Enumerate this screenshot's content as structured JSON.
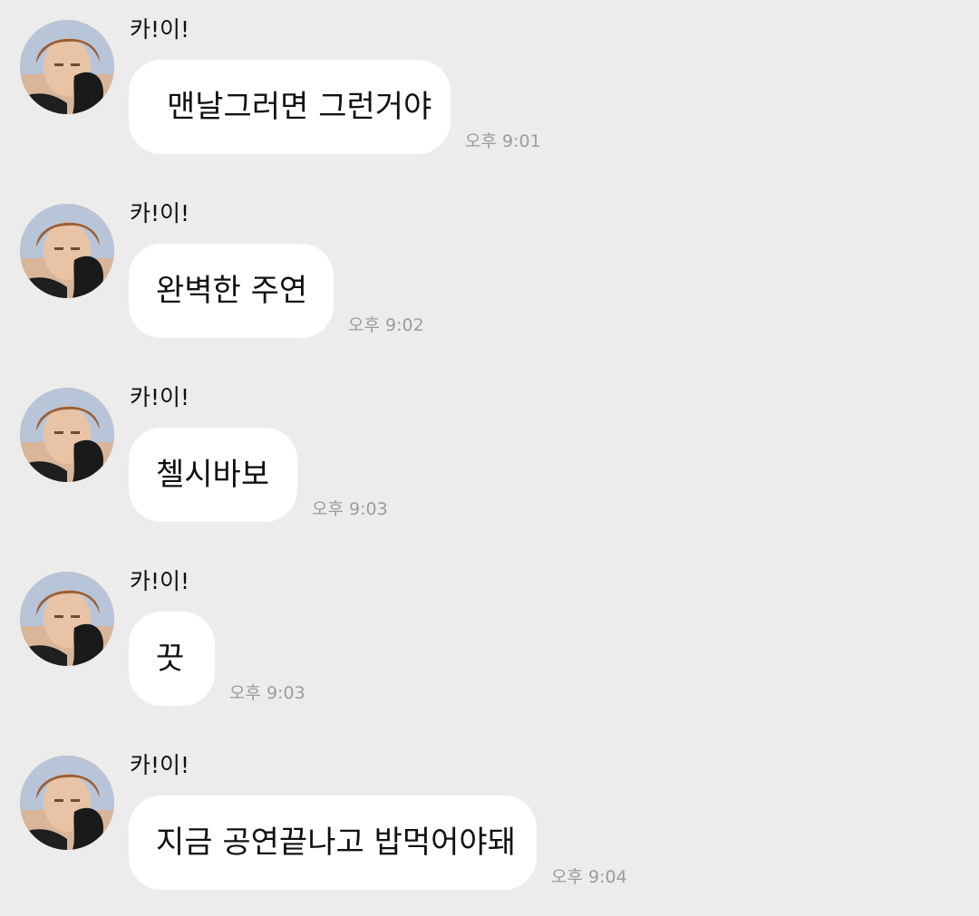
{
  "messages": [
    {
      "sender": "카!이!",
      "text": "맨날그러면 그런거야",
      "time": "오후 9:01"
    },
    {
      "sender": "카!이!",
      "text": "완벽한 주연",
      "time": "오후 9:02"
    },
    {
      "sender": "카!이!",
      "text": "첼시바보",
      "time": "오후 9:03"
    },
    {
      "sender": "카!이!",
      "text": "끗",
      "time": "오후 9:03"
    },
    {
      "sender": "카!이!",
      "text": "지금 공연끝나고 밥먹어야돼",
      "time": "오후 9:04"
    }
  ],
  "colors": {
    "background": "#ececec",
    "bubble": "#ffffff",
    "text": "#111111",
    "time": "#9c9c9c"
  }
}
